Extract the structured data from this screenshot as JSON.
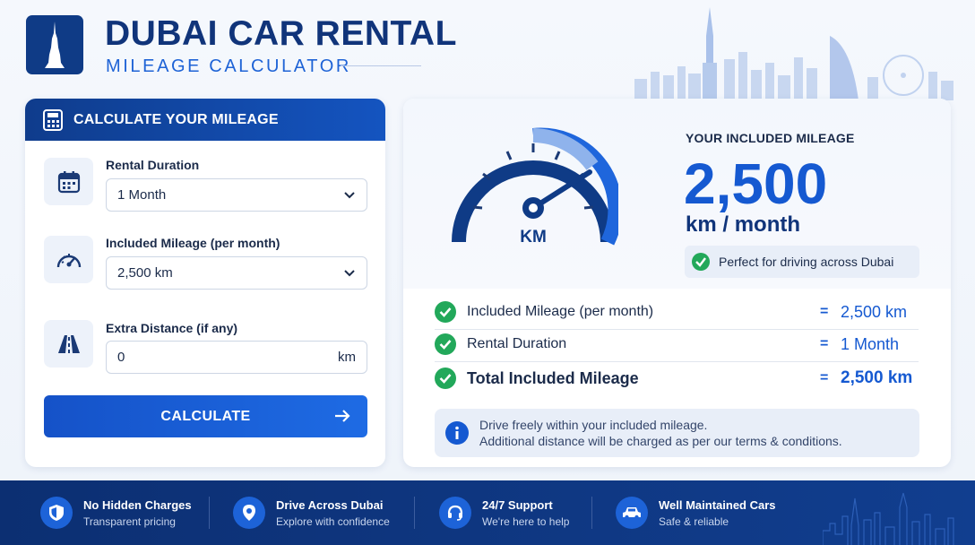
{
  "header": {
    "title": "DUBAI CAR RENTAL",
    "subtitle": "MILEAGE CALCULATOR"
  },
  "calculator": {
    "heading": "CALCULATE YOUR MILEAGE",
    "fields": [
      {
        "label": "Rental Duration",
        "value": "1 Month",
        "icon": "calendar-icon"
      },
      {
        "label": "Included Mileage (per month)",
        "value": "2,500 km",
        "icon": "speedometer-icon"
      },
      {
        "label": "Extra Distance (if any)",
        "value": "0",
        "unit": "km",
        "icon": "road-icon"
      }
    ],
    "button_label": "CALCULATE"
  },
  "result": {
    "gauge_label": "KM",
    "included_label": "YOUR INCLUDED MILEAGE",
    "included_value": "2,500",
    "included_unit": "km / month",
    "perfect_note": "Perfect for driving across Dubai",
    "rows": [
      {
        "label": "Included Mileage (per month)",
        "eq": "=",
        "value": "2,500 km"
      },
      {
        "label": "Rental Duration",
        "eq": "=",
        "value": "1 Month"
      },
      {
        "label": "Total Included Mileage",
        "eq": "=",
        "value": "2,500 km"
      }
    ],
    "info_line1": "Drive freely within your included mileage.",
    "info_line2": "Additional distance will be charged as per our terms & conditions."
  },
  "footer": {
    "features": [
      {
        "title": "No Hidden Charges",
        "sub": "Transparent pricing",
        "icon": "shield-icon"
      },
      {
        "title": "Drive Across Dubai",
        "sub": "Explore with confidence",
        "icon": "location-pin-icon"
      },
      {
        "title": "24/7 Support",
        "sub": "We're here to help",
        "icon": "headset-icon"
      },
      {
        "title": "Well Maintained Cars",
        "sub": "Safe & reliable",
        "icon": "car-icon"
      }
    ]
  },
  "colors": {
    "primary": "#1559d1",
    "navy": "#10347a",
    "success": "#22a85a"
  }
}
